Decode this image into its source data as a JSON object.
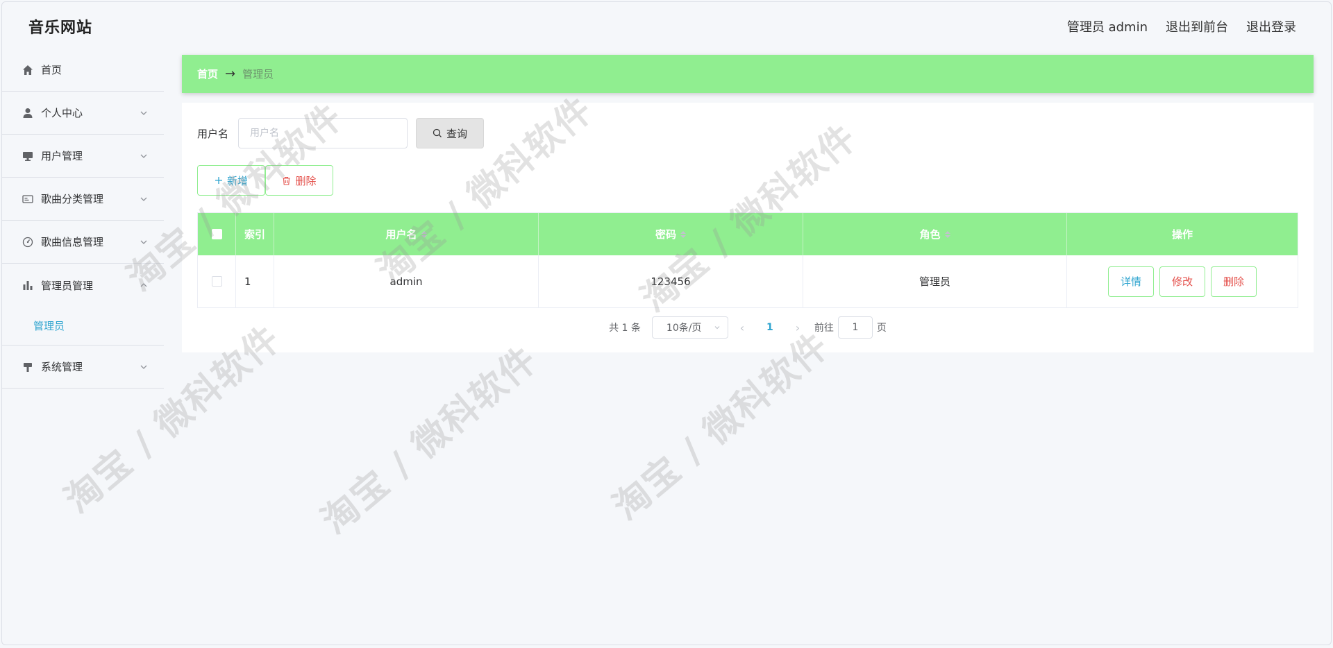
{
  "header": {
    "site_title": "音乐网站",
    "admin_label": "管理员 admin",
    "front_label": "退出到前台",
    "logout_label": "退出登录"
  },
  "sidebar": {
    "items": [
      {
        "label": "首页",
        "icon": "home-icon"
      },
      {
        "label": "个人中心",
        "icon": "user-icon"
      },
      {
        "label": "用户管理",
        "icon": "monitor-icon"
      },
      {
        "label": "歌曲分类管理",
        "icon": "id-card-icon"
      },
      {
        "label": "歌曲信息管理",
        "icon": "dashboard-icon"
      },
      {
        "label": "管理员管理",
        "icon": "bar-chart-icon"
      },
      {
        "label": "系统管理",
        "icon": "brush-icon"
      }
    ],
    "sub_item": "管理员"
  },
  "breadcrumb": {
    "home": "首页",
    "separator": "→",
    "current": "管理员"
  },
  "search": {
    "label": "用户名",
    "placeholder": "用户名",
    "button": "查询"
  },
  "actions": {
    "add": "新增",
    "delete": "删除"
  },
  "table": {
    "headers": [
      "索引",
      "用户名",
      "密码",
      "角色",
      "操作"
    ],
    "rows": [
      {
        "index": "1",
        "username": "admin",
        "password": "123456",
        "role": "管理员"
      }
    ],
    "row_actions": {
      "detail": "详情",
      "edit": "修改",
      "delete": "删除"
    }
  },
  "pagination": {
    "total": "共 1 条",
    "page_size": "10条/页",
    "current_page": "1",
    "goto_prefix": "前往",
    "goto_value": "1",
    "goto_suffix": "页"
  },
  "watermark": "淘宝 / 微科软件",
  "colors": {
    "accent_green": "#90ee90",
    "link_blue": "#2ea4cf",
    "danger_red": "#e4504b",
    "background": "#f5f7fa"
  }
}
